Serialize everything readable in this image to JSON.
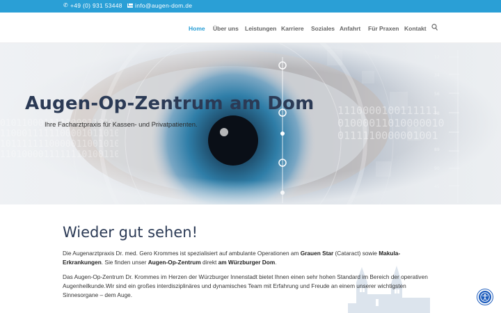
{
  "topbar": {
    "phone": "+49 (0) 931 53448",
    "email": "info@augen-dom.de"
  },
  "nav": {
    "items": [
      {
        "label": "Home",
        "active": true
      },
      {
        "label": "Über uns",
        "active": false
      },
      {
        "label": "Leistungen",
        "active": false
      },
      {
        "label": "Karriere",
        "active": false
      },
      {
        "label": "Soziales",
        "active": false
      },
      {
        "label": "Anfahrt",
        "active": false
      },
      {
        "label": "Für Praxen",
        "active": false
      },
      {
        "label": "Kontakt",
        "active": false
      }
    ],
    "search_icon": "search-icon"
  },
  "hero": {
    "title": "Augen-Op-Zentrum am Dom",
    "subtitle": "Ihre Facharztpraxis für Kassen- und Privatpatienten.",
    "binary_left": "010110001111100011010\n1100011111100001011010\n1011111110000011001010\n1101000011111110100110",
    "binary_right": "1110000100111111\n01000011010000010\n0111110000001001"
  },
  "content": {
    "heading": "Wieder gut sehen!",
    "p1": {
      "t1": "Die Augenarztpraxis Dr. med. Gero Krommes ist spezialisiert auf ambulante Operationen am ",
      "b1": "Grauen Star",
      "t2": " (Cataract) sowie ",
      "b2": "Makula-Erkrankungen",
      "t3": ". Sie finden unser ",
      "b3": "Augen-Op-Zentrum",
      "t4": " direkt ",
      "b4": "am Würzburger Dom",
      "t5": "."
    },
    "p2": "Das Augen-Op-Zentrum Dr. Krommes im Herzen der Würzburger Innenstadt bietet Ihnen einen sehr hohen Standard im Bereich der operativen Augenheilkunde.Wir sind ein großes interdisziplinäres und dynamisches Team mit Erfahrung und Freude an einem unserer wichtigsten Sinnesorgane – dem Auge."
  },
  "accessibility": {
    "icon": "accessibility-icon"
  },
  "colors": {
    "topbar": "#2a9fd6",
    "nav_active": "#2a9fd6",
    "nav_text": "#666666",
    "title": "#2b3a55",
    "a11y": "#1e5dbd"
  }
}
